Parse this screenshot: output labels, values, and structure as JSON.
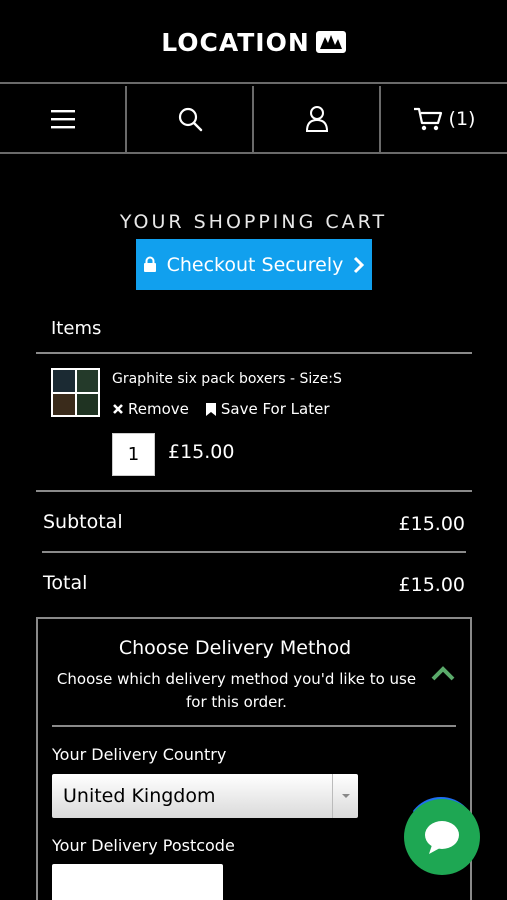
{
  "header": {
    "brand": "LOCATION",
    "logo_icon": "location-mark-icon"
  },
  "nav": {
    "items": [
      {
        "icon": "hamburger-menu-icon"
      },
      {
        "icon": "search-icon"
      },
      {
        "icon": "account-icon"
      },
      {
        "icon": "cart-icon",
        "count": "(1)"
      }
    ]
  },
  "cart": {
    "title": "YOUR SHOPPING CART",
    "checkout_label": "Checkout Securely",
    "items_heading": "Items",
    "items": [
      {
        "name": "Graphite six pack boxers - Size:S",
        "remove_label": "Remove",
        "save_label": "Save For Later",
        "quantity": "1",
        "price": "£15.00"
      }
    ],
    "subtotal_label": "Subtotal",
    "subtotal_value": "£15.00",
    "total_label": "Total",
    "total_value": "£15.00"
  },
  "delivery": {
    "title": "Choose Delivery Method",
    "subtitle": "Choose which delivery method you'd like to use for this order.",
    "country_label": "Your Delivery Country",
    "country_value": "United Kingdom",
    "postcode_label": "Your Delivery Postcode",
    "postcode_value": ""
  },
  "colors": {
    "accent": "#11a0ee",
    "chat": "#1ea753",
    "chevron": "#5aaa6a",
    "background": "#000000"
  }
}
